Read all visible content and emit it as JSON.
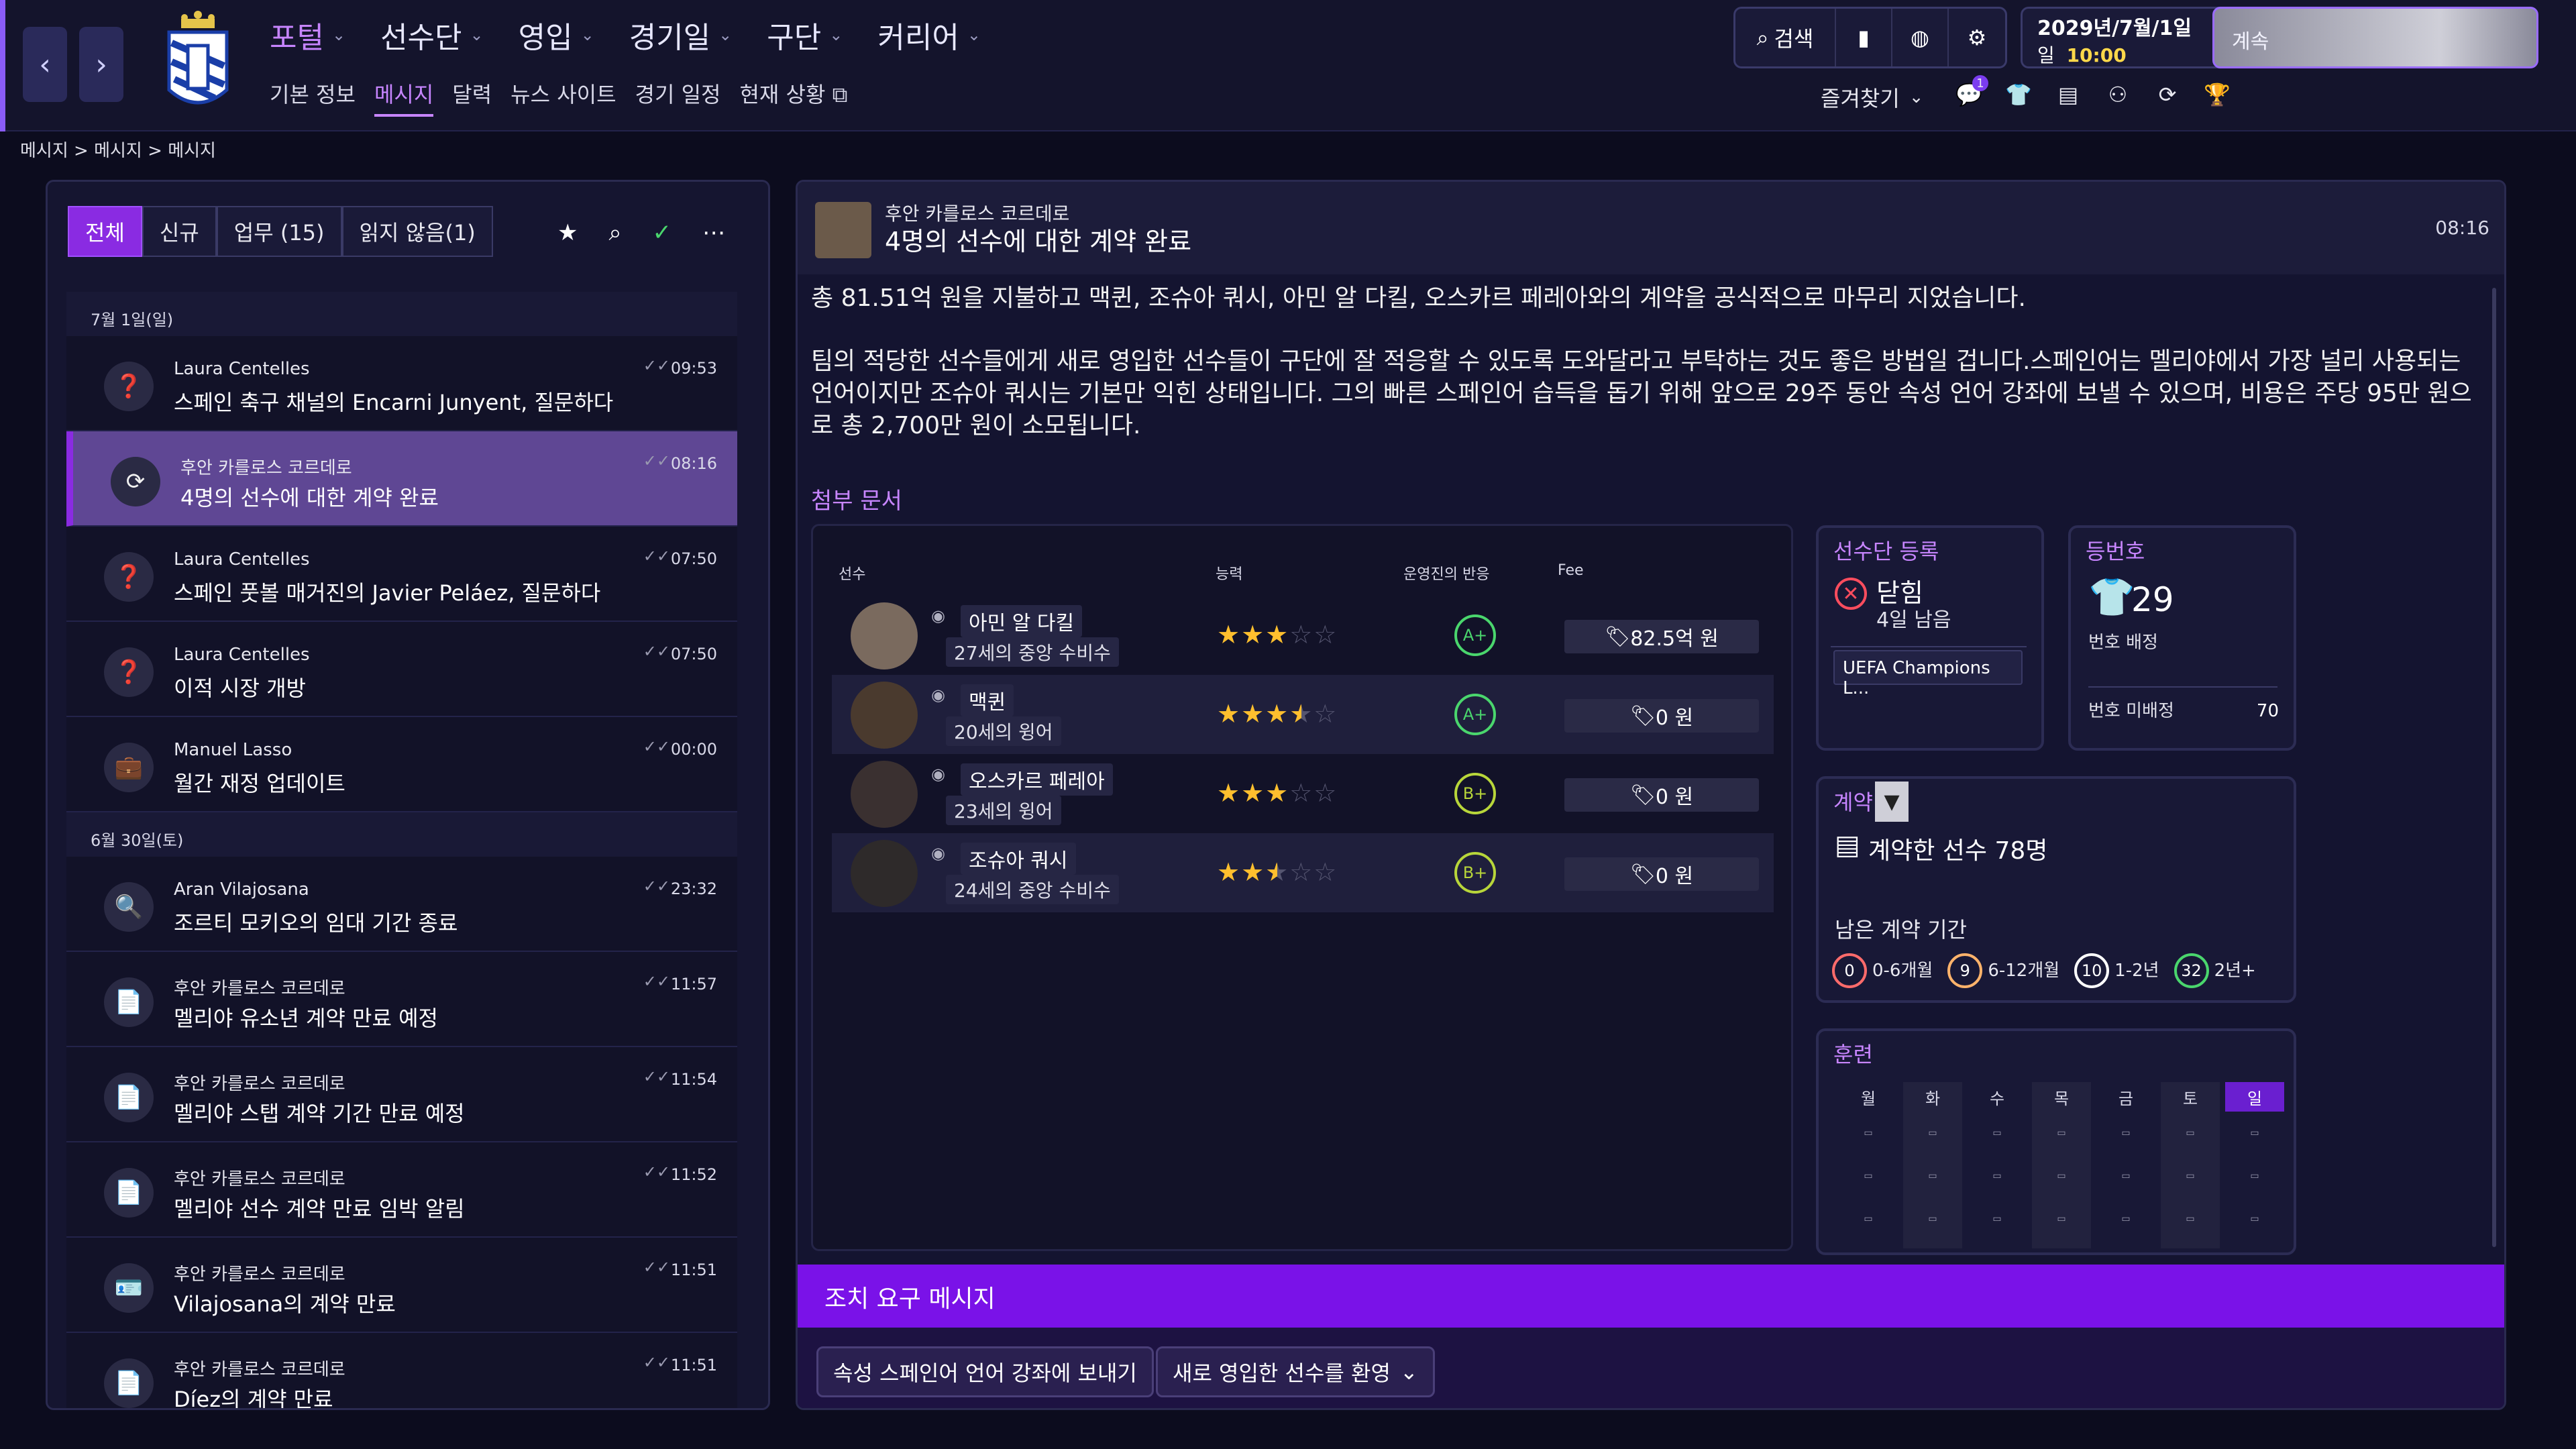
{
  "nav": {
    "main": [
      {
        "label": "포털",
        "active": true
      },
      {
        "label": "선수단"
      },
      {
        "label": "영입"
      },
      {
        "label": "경기일"
      },
      {
        "label": "구단"
      },
      {
        "label": "커리어"
      }
    ],
    "sub": [
      {
        "label": "기본 정보"
      },
      {
        "label": "메시지",
        "active": true
      },
      {
        "label": "달력"
      },
      {
        "label": "뉴스 사이트"
      },
      {
        "label": "경기 일정"
      },
      {
        "label": "현재 상황"
      }
    ],
    "search_label": "검색",
    "date": "2029년/7월/1일",
    "day": "일",
    "time": "10:00",
    "continue_label": "계속",
    "favorites_label": "즐겨찾기",
    "notification_count": "1"
  },
  "breadcrumb": [
    "메시지",
    "메시지",
    "메시지"
  ],
  "inbox": {
    "tabs": [
      "전체",
      "신규",
      "업무 (15)",
      "읽지 않음(1)"
    ],
    "groups": [
      {
        "date": "7월 1일(일)",
        "messages": [
          {
            "from": "Laura Centelles",
            "subject": "스페인 축구 채널의 Encarni Junyent, 질문하다",
            "time": "09:53",
            "icon": "question-icon"
          },
          {
            "from": "후안 카를로스 코르데로",
            "subject": "4명의 선수에 대한 계약 완료",
            "time": "08:16",
            "icon": "refresh-icon",
            "active": true
          },
          {
            "from": "Laura Centelles",
            "subject": "스페인 풋볼 매거진의 Javier Peláez, 질문하다",
            "time": "07:50",
            "icon": "question-icon"
          },
          {
            "from": "Laura Centelles",
            "subject": "이적 시장 개방",
            "time": "07:50",
            "icon": "question-icon"
          },
          {
            "from": "Manuel Lasso",
            "subject": "월간 재정 업데이트",
            "time": "00:00",
            "icon": "briefcase-icon"
          }
        ]
      },
      {
        "date": "6월 30일(토)",
        "messages": [
          {
            "from": "Aran Vilajosana",
            "subject": "조르티 모키오의 임대 기간 종료",
            "time": "23:32",
            "icon": "search-icon"
          },
          {
            "from": "후안 카를로스 코르데로",
            "subject": "멜리야 유소년 계약 만료 예정",
            "time": "11:57",
            "icon": "document-icon"
          },
          {
            "from": "후안 카를로스 코르데로",
            "subject": "멜리야 스탭 계약 기간 만료 예정",
            "time": "11:54",
            "icon": "document-icon"
          },
          {
            "from": "후안 카를로스 코르데로",
            "subject": "멜리야 선수 계약 만료 임박 알림",
            "time": "11:52",
            "icon": "document-icon"
          },
          {
            "from": "후안 카를로스 코르데로",
            "subject": "Vilajosana의 계약 만료",
            "time": "11:51",
            "icon": "id-card-icon"
          },
          {
            "from": "후안 카를로스 코르데로",
            "subject": "Díez의 계약 만료",
            "time": "11:51",
            "icon": "document-icon"
          }
        ]
      }
    ]
  },
  "message": {
    "from": "후안 카를로스 코르데로",
    "subject": "4명의 선수에 대한 계약 완료",
    "time": "08:16",
    "body": [
      "총 81.51억 원을 지불하고 맥퀸, 조슈아 쿼시, 아민 알 다킬, 오스카르 페레아와의 계약을 공식적으로 마무리 지었습니다.",
      "팀의 적당한 선수들에게 새로 영입한 선수들이 구단에 잘 적응할 수 있도록 도와달라고 부탁하는 것도 좋은 방법일 겁니다.스페인어는 멜리야에서 가장 널리 사용되는 언어이지만 조슈아 쿼시는 기본만 익힌 상태입니다. 그의 빠른 스페인어 습득을 돕기 위해 앞으로 29주 동안 속성 언어 강좌에 보낼 수 있으며, 비용은 주당 95만 원으로 총 2,700만 원이 소모됩니다."
    ],
    "attachments_label": "첨부 문서",
    "table": {
      "headers": {
        "player": "선수",
        "ability": "능력",
        "reaction": "운영진의 반응",
        "fee": "Fee"
      },
      "rows": [
        {
          "name": "아민 알 다킬",
          "desc": "27세의 중앙 수비수",
          "stars": 3,
          "grade": "A+",
          "fee": "82.5억 원"
        },
        {
          "name": "맥퀸",
          "desc": "20세의 윙어",
          "stars": 3.5,
          "grade": "A+",
          "fee": "0 원"
        },
        {
          "name": "오스카르 페레아",
          "desc": "23세의 윙어",
          "stars": 3,
          "grade": "B+",
          "fee": "0 원"
        },
        {
          "name": "조슈아 쿼시",
          "desc": "24세의 중앙 수비수",
          "stars": 2.5,
          "grade": "B+",
          "fee": "0 원"
        }
      ]
    },
    "squad_registration": {
      "title": "선수단 등록",
      "status": "닫힘",
      "remaining": "4일 남음",
      "competition": "UEFA Champions L..."
    },
    "squad_number": {
      "title": "등번호",
      "number": "29",
      "label": "번호 배정",
      "unassigned_label": "번호 미배정",
      "unassigned": "70"
    },
    "contracts": {
      "title": "계약",
      "count_label": "계약한 선수 78명",
      "remaining_label": "남은 계약 기간",
      "buckets": [
        {
          "count": "0",
          "label": "0-6개월",
          "color": "#ff6b6b"
        },
        {
          "count": "9",
          "label": "6-12개월",
          "color": "#ffb36b"
        },
        {
          "count": "10",
          "label": "1-2년",
          "color": "#ffffff"
        },
        {
          "count": "32",
          "label": "2년+",
          "color": "#4ad66d"
        }
      ]
    },
    "training": {
      "title": "훈련",
      "days": [
        "월",
        "화",
        "수",
        "목",
        "금",
        "토",
        "일"
      ],
      "selected_day": "일"
    },
    "action_required_label": "조치 요구 메시지",
    "actions": [
      "속성 스페인어 언어 강좌에 보내기",
      "새로 영입한 선수를 환영"
    ]
  }
}
